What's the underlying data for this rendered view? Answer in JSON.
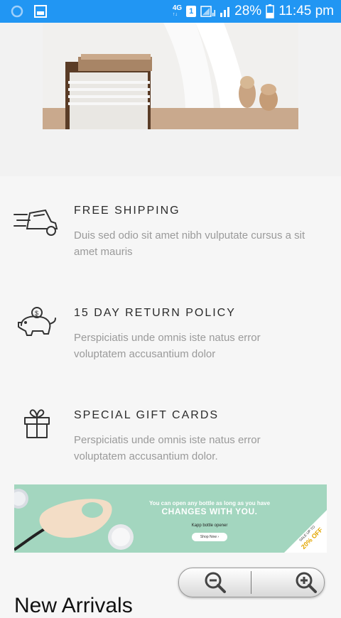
{
  "status_bar": {
    "network": "4G",
    "sim_slot": "1",
    "battery": "28%",
    "time": "11:45 pm",
    "color": "#2196f3"
  },
  "features": [
    {
      "icon": "delivery-truck-icon",
      "title": "FREE SHIPPING",
      "description": "Duis sed odio sit amet nibh vulputate cursus a sit amet mauris"
    },
    {
      "icon": "piggy-bank-icon",
      "title": "15 DAY RETURN POLICY",
      "description": "Perspiciatis unde omnis iste natus error voluptatem accusantium dolor"
    },
    {
      "icon": "gift-icon",
      "title": "SPECIAL GIFT CARDS",
      "description": "Perspiciatis unde omnis iste natus error voluptatem accusantium dolor."
    }
  ],
  "banner": {
    "line1": "You can open any bottle as long as you have",
    "line2": "CHANGES WITH YOU.",
    "line3": "Kapp bottle opener",
    "button": "Shop Now",
    "ribbon_top": "SALE UP TO",
    "ribbon_value": "20% OFF",
    "color": "#a3d6bf"
  },
  "zoom": {
    "out_icon": "zoom-out-icon",
    "in_icon": "zoom-in-icon"
  },
  "bottom_heading": "New Arrivals"
}
